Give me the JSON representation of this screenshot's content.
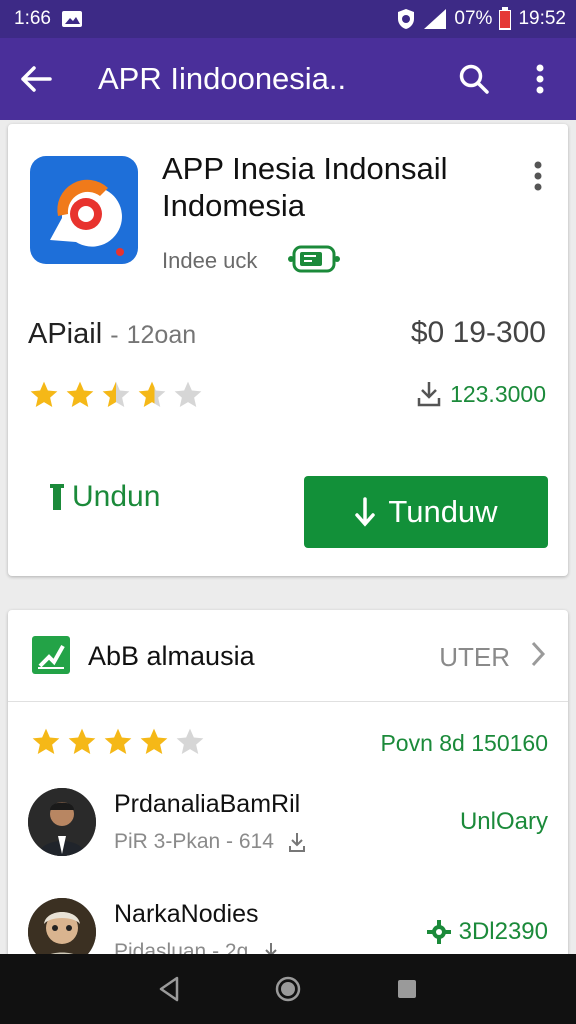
{
  "status_bar": {
    "time_left": "1:66",
    "battery_percent": "07%",
    "time_right": "19:52"
  },
  "app_bar": {
    "title": "APR Iindoonesia.."
  },
  "app_card": {
    "name": "APP Inesia Indonsail Indomesia",
    "developer": "Indee uck",
    "category": "APiail",
    "category_sep": "-",
    "category_sub": "12oan",
    "price": "$0 19-300",
    "rating": 3.5,
    "downloads": "123.3000",
    "secondary_button": "Undun",
    "primary_button": "Tunduw"
  },
  "reviews_section": {
    "title": "AbB almausia",
    "link": "UTER",
    "rating": 4,
    "summary": "Povn 8d 150160",
    "reviews": [
      {
        "name": "PrdanaliaBamRil",
        "sub": "PiR 3-Pkan - 614",
        "action": "UnlOary"
      },
      {
        "name": "NarkaNodies",
        "sub": "Pidasluan - 2g",
        "action": "3Dl2390"
      }
    ]
  },
  "colors": {
    "status_bar": "#3d2a86",
    "app_bar": "#4a2f9a",
    "accent_green": "#129039",
    "star": "#f5b817"
  }
}
